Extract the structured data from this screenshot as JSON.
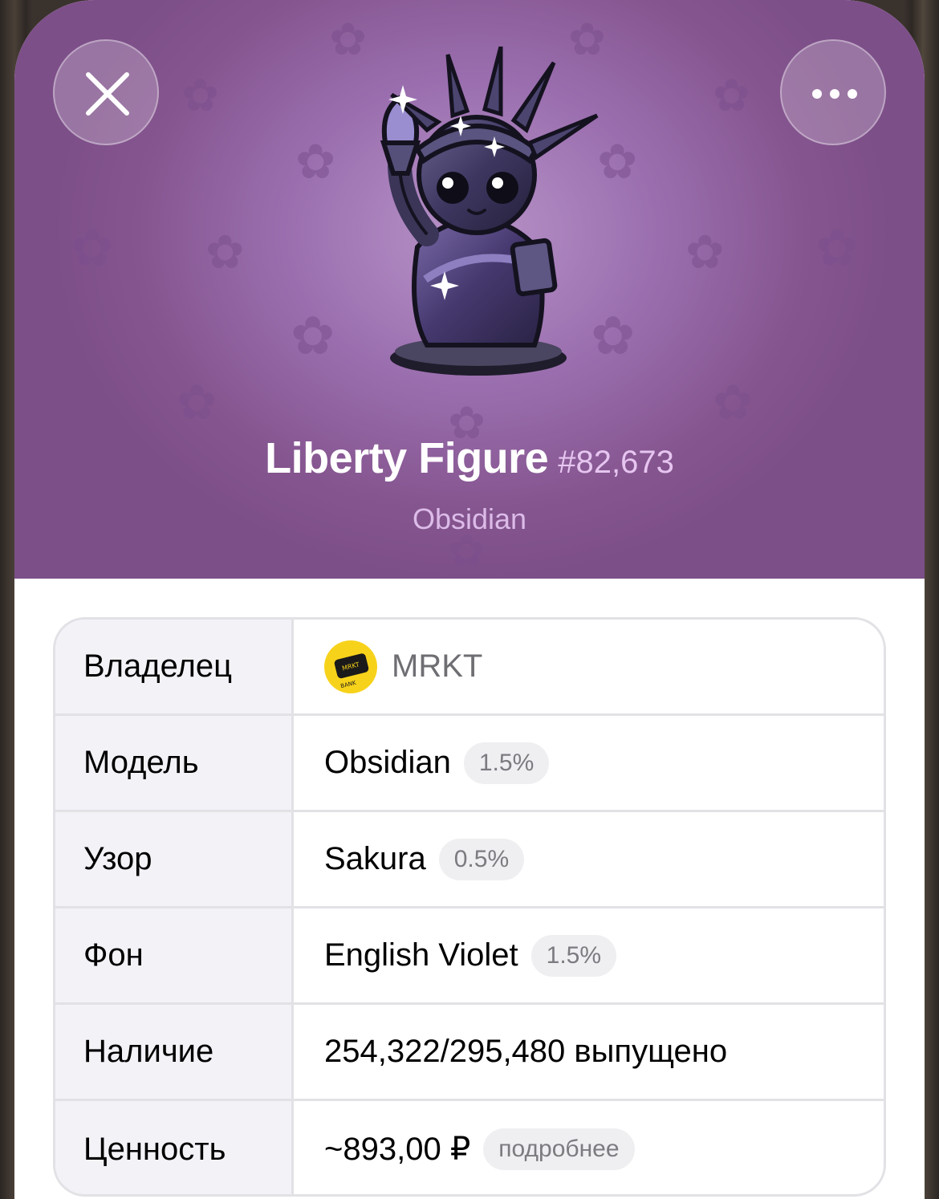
{
  "header": {
    "close_icon": "close-icon",
    "more_icon": "more-dots-icon",
    "gift_name": "Liberty Figure",
    "gift_number": "#82,673",
    "subtitle": "Obsidian",
    "background_color": "#85558f",
    "pattern_icon": "sakura-flower-icon",
    "figure_image": "liberty-figure-obsidian"
  },
  "details": {
    "owner": {
      "label": "Владелец",
      "value": "MRKT",
      "avatar_icon": "mrkt-bank-logo"
    },
    "model": {
      "label": "Модель",
      "value": "Obsidian",
      "badge": "1.5%"
    },
    "pattern": {
      "label": "Узор",
      "value": "Sakura",
      "badge": "0.5%"
    },
    "backdrop": {
      "label": "Фон",
      "value": "English Violet",
      "badge": "1.5%"
    },
    "availability": {
      "label": "Наличие",
      "value": "254,322/295,480 выпущено"
    },
    "value": {
      "label": "Ценность",
      "value": "~893,00 ₽",
      "badge": "подробнее"
    }
  }
}
